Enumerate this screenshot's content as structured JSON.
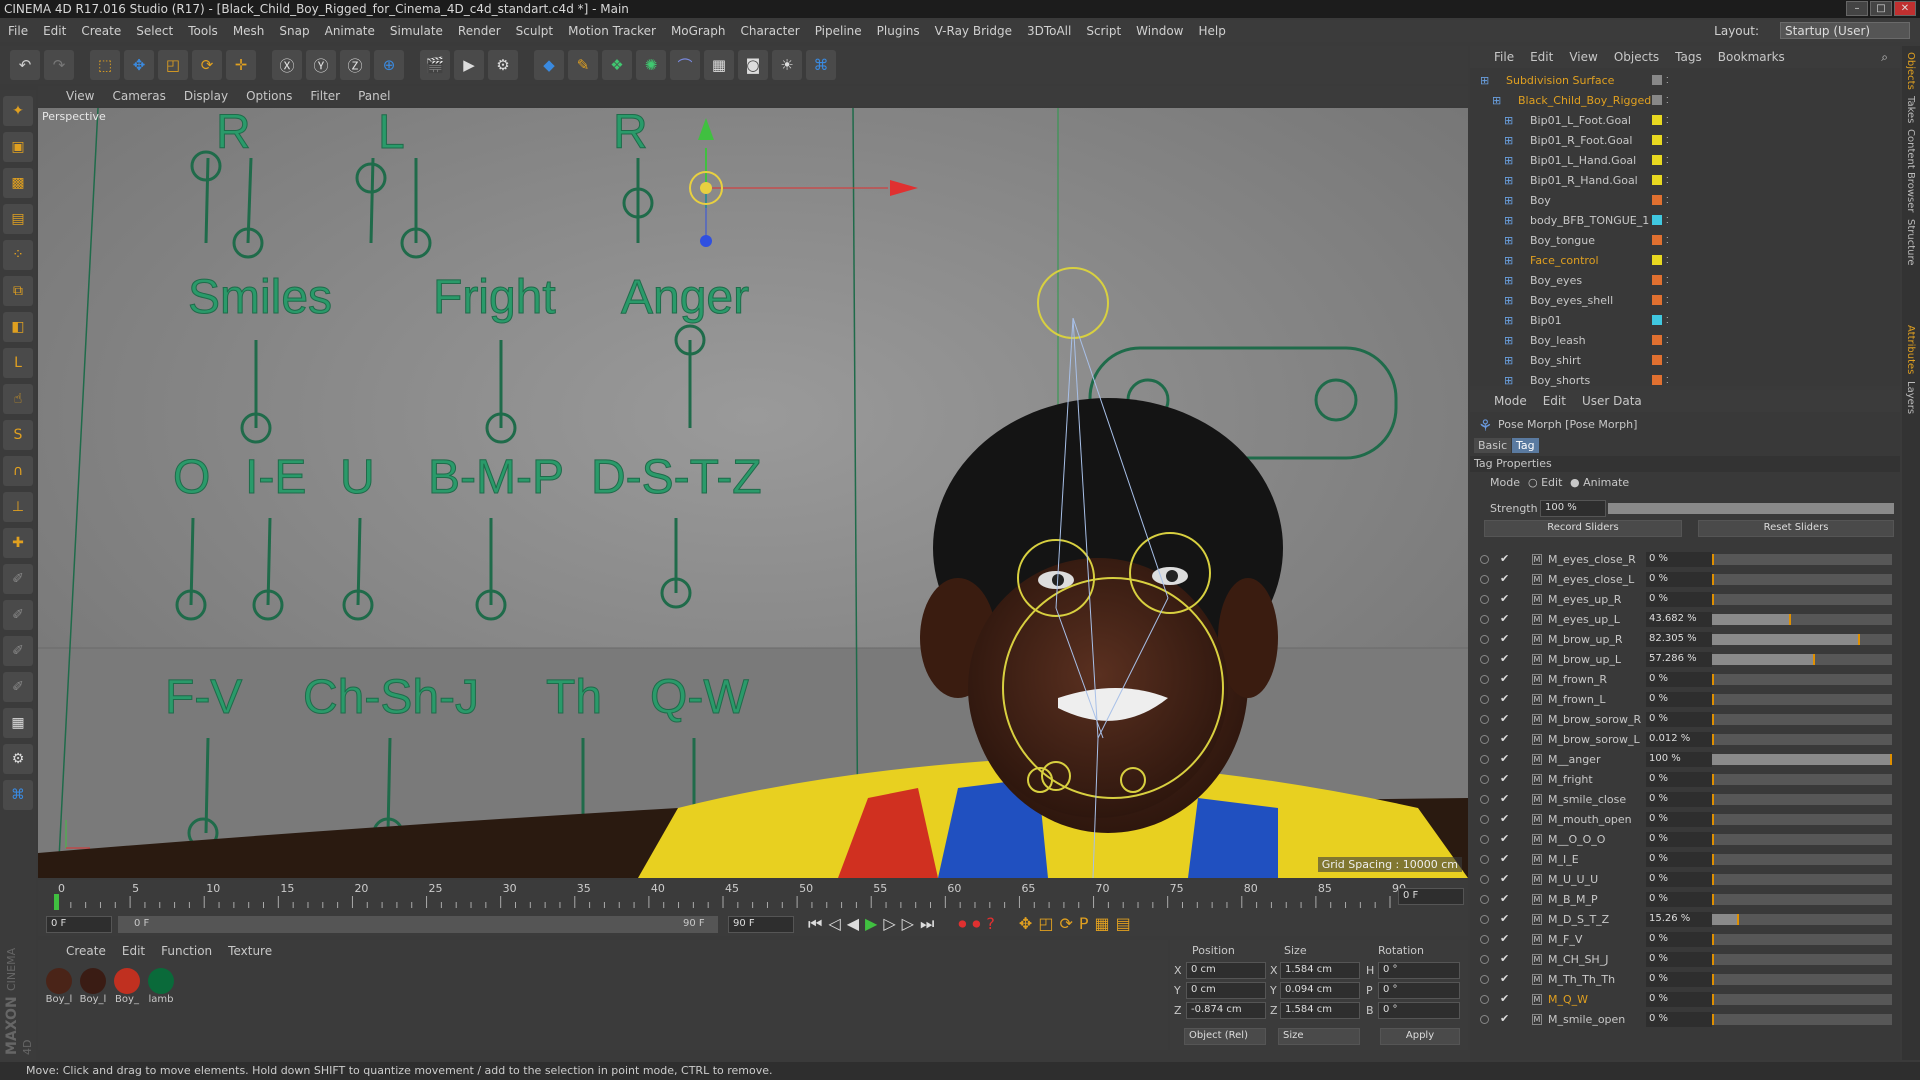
{
  "window": {
    "title": "CINEMA 4D R17.016 Studio (R17) - [Black_Child_Boy_Rigged_for_Cinema_4D_c4d_standart.c4d *] - Main"
  },
  "menubar": {
    "items": [
      "File",
      "Edit",
      "Create",
      "Select",
      "Tools",
      "Mesh",
      "Snap",
      "Animate",
      "Simulate",
      "Render",
      "Sculpt",
      "Motion Tracker",
      "MoGraph",
      "Character",
      "Pipeline",
      "Plugins",
      "V-Ray Bridge",
      "3DToAll",
      "Script",
      "Window",
      "Help"
    ],
    "layout_label": "Layout:",
    "layout_value": "Startup (User)"
  },
  "viewport": {
    "menu": [
      "View",
      "Cameras",
      "Display",
      "Options",
      "Filter",
      "Panel"
    ],
    "label": "Perspective",
    "grid_spacing": "Grid Spacing : 10000 cm",
    "face_labels": {
      "r1": "R",
      "l1": "L",
      "r2": "R",
      "smiles": "Smiles",
      "fright": "Fright",
      "anger": "Anger",
      "o": "O",
      "ie": "I-E",
      "u": "U",
      "bmp": "B-M-P",
      "dstz": "D-S-T-Z",
      "fv": "F-V",
      "chshj": "Ch-Sh-J",
      "th": "Th",
      "qw": "Q-W"
    }
  },
  "timeline": {
    "ticks": [
      "0",
      "5",
      "10",
      "15",
      "20",
      "25",
      "30",
      "35",
      "40",
      "45",
      "50",
      "55",
      "60",
      "65",
      "70",
      "75",
      "80",
      "85",
      "90"
    ],
    "current_frame": "0 F",
    "start_field": "0 F",
    "range_start": "0 F",
    "range_end": "90 F",
    "end_field": "90 F"
  },
  "material_manager": {
    "menu": [
      "Create",
      "Edit",
      "Function",
      "Texture"
    ],
    "materials": [
      {
        "name": "Boy_l",
        "color": "#4a2418"
      },
      {
        "name": "Boy_l",
        "color": "#3a1c14"
      },
      {
        "name": "Boy_",
        "color": "#c03020"
      },
      {
        "name": "lamb",
        "color": "#0a6a3a"
      }
    ]
  },
  "coordinates": {
    "headers": {
      "position": "Position",
      "size": "Size",
      "rotation": "Rotation"
    },
    "rows": [
      {
        "axis": "X",
        "pos": "0 cm",
        "size_axis": "X",
        "size": "1.584 cm",
        "rot_axis": "H",
        "rot": "0 °"
      },
      {
        "axis": "Y",
        "pos": "0 cm",
        "size_axis": "Y",
        "size": "0.094 cm",
        "rot_axis": "P",
        "rot": "0 °"
      },
      {
        "axis": "Z",
        "pos": "-0.874 cm",
        "size_axis": "Z",
        "size": "1.584 cm",
        "rot_axis": "B",
        "rot": "0 °"
      }
    ],
    "mode": "Object (Rel)",
    "size_mode": "Size",
    "apply": "Apply"
  },
  "status": "Move: Click and drag to move elements. Hold down SHIFT to quantize movement / add to the selection in point mode, CTRL to remove.",
  "maxon": {
    "brand": "MAXON",
    "product": "CINEMA 4D"
  },
  "object_manager": {
    "menu": [
      "File",
      "Edit",
      "View",
      "Objects",
      "Tags",
      "Bookmarks"
    ],
    "objects": [
      {
        "name": "Subdivision Surface",
        "indent": 0,
        "color": "#e0a020",
        "chip": "#888888"
      },
      {
        "name": "Black_Child_Boy_Rigged",
        "indent": 1,
        "color": "#e0a020",
        "chip": "#888888"
      },
      {
        "name": "Bip01_L_Foot.Goal",
        "indent": 2,
        "color": "#c8c8c8",
        "chip": "#e8d820"
      },
      {
        "name": "Bip01_R_Foot.Goal",
        "indent": 2,
        "color": "#c8c8c8",
        "chip": "#e8d820"
      },
      {
        "name": "Bip01_L_Hand.Goal",
        "indent": 2,
        "color": "#c8c8c8",
        "chip": "#e8d820"
      },
      {
        "name": "Bip01_R_Hand.Goal",
        "indent": 2,
        "color": "#c8c8c8",
        "chip": "#e8d820"
      },
      {
        "name": "Boy",
        "indent": 2,
        "color": "#c8c8c8",
        "chip": "#e07030"
      },
      {
        "name": "body_BFB_TONGUE_1",
        "indent": 2,
        "color": "#c8c8c8",
        "chip": "#40c8e0"
      },
      {
        "name": "Boy_tongue",
        "indent": 2,
        "color": "#c8c8c8",
        "chip": "#e07030"
      },
      {
        "name": "Face_control",
        "indent": 2,
        "color": "#e0a020",
        "chip": "#e8d820"
      },
      {
        "name": "Boy_eyes",
        "indent": 2,
        "color": "#c8c8c8",
        "chip": "#e07030"
      },
      {
        "name": "Boy_eyes_shell",
        "indent": 2,
        "color": "#c8c8c8",
        "chip": "#e07030"
      },
      {
        "name": "Bip01",
        "indent": 2,
        "color": "#c8c8c8",
        "chip": "#40c8e0"
      },
      {
        "name": "Boy_leash",
        "indent": 2,
        "color": "#c8c8c8",
        "chip": "#e07030"
      },
      {
        "name": "Boy_shirt",
        "indent": 2,
        "color": "#c8c8c8",
        "chip": "#e07030"
      },
      {
        "name": "Boy_shorts",
        "indent": 2,
        "color": "#c8c8c8",
        "chip": "#e07030"
      }
    ]
  },
  "attributes": {
    "menu": [
      "Mode",
      "Edit",
      "User Data"
    ],
    "title": "Pose Morph [Pose Morph]",
    "tabs": [
      "Basic",
      "Tag"
    ],
    "section": "Tag Properties",
    "mode_label": "Mode",
    "mode_edit": "Edit",
    "mode_animate": "Animate",
    "strength_label": "Strength",
    "strength_value": "100 %",
    "record_sliders": "Record Sliders",
    "reset_sliders": "Reset Sliders",
    "sliders": [
      {
        "name": "M_eyes_close_R",
        "value": "0 %",
        "frac": 0
      },
      {
        "name": "M_eyes_close_L",
        "value": "0 %",
        "frac": 0
      },
      {
        "name": "M_eyes_up_R",
        "value": "0 %",
        "frac": 0
      },
      {
        "name": "M_eyes_up_L",
        "value": "43.682 %",
        "frac": 0.43682
      },
      {
        "name": "M_brow_up_R",
        "value": "82.305 %",
        "frac": 0.82305
      },
      {
        "name": "M_brow_up_L",
        "value": "57.286 %",
        "frac": 0.57286
      },
      {
        "name": "M_frown_R",
        "value": "0 %",
        "frac": 0
      },
      {
        "name": "M_frown_L",
        "value": "0 %",
        "frac": 0
      },
      {
        "name": "M_brow_sorow_R",
        "value": "0 %",
        "frac": 0
      },
      {
        "name": "M_brow_sorow_L",
        "value": "0.012 %",
        "frac": 0.00012
      },
      {
        "name": "M__anger",
        "value": "100 %",
        "frac": 1
      },
      {
        "name": "M_fright",
        "value": "0 %",
        "frac": 0
      },
      {
        "name": "M_smile_close",
        "value": "0 %",
        "frac": 0
      },
      {
        "name": "M_mouth_open",
        "value": "0 %",
        "frac": 0
      },
      {
        "name": "M__O_O_O",
        "value": "0 %",
        "frac": 0
      },
      {
        "name": "M_I_E",
        "value": "0 %",
        "frac": 0
      },
      {
        "name": "M_U_U_U",
        "value": "0 %",
        "frac": 0
      },
      {
        "name": "M_B_M_P",
        "value": "0 %",
        "frac": 0
      },
      {
        "name": "M_D_S_T_Z",
        "value": "15.26 %",
        "frac": 0.1526
      },
      {
        "name": "M_F_V",
        "value": "0 %",
        "frac": 0
      },
      {
        "name": "M_CH_SH_J",
        "value": "0 %",
        "frac": 0
      },
      {
        "name": "M_Th_Th_Th",
        "value": "0 %",
        "frac": 0
      },
      {
        "name": "M_Q_W",
        "value": "0 %",
        "frac": 0,
        "highlight": true
      },
      {
        "name": "M_smile_open",
        "value": "0 %",
        "frac": 0
      }
    ]
  },
  "right_tabs": [
    "Objects",
    "Takes",
    "Content Browser",
    "Structure",
    "Attributes",
    "Layers"
  ],
  "colors": {
    "accent": "#e0a020",
    "rig_green": "#1f6b4a",
    "gizmo_yellow": "#e8d040"
  }
}
